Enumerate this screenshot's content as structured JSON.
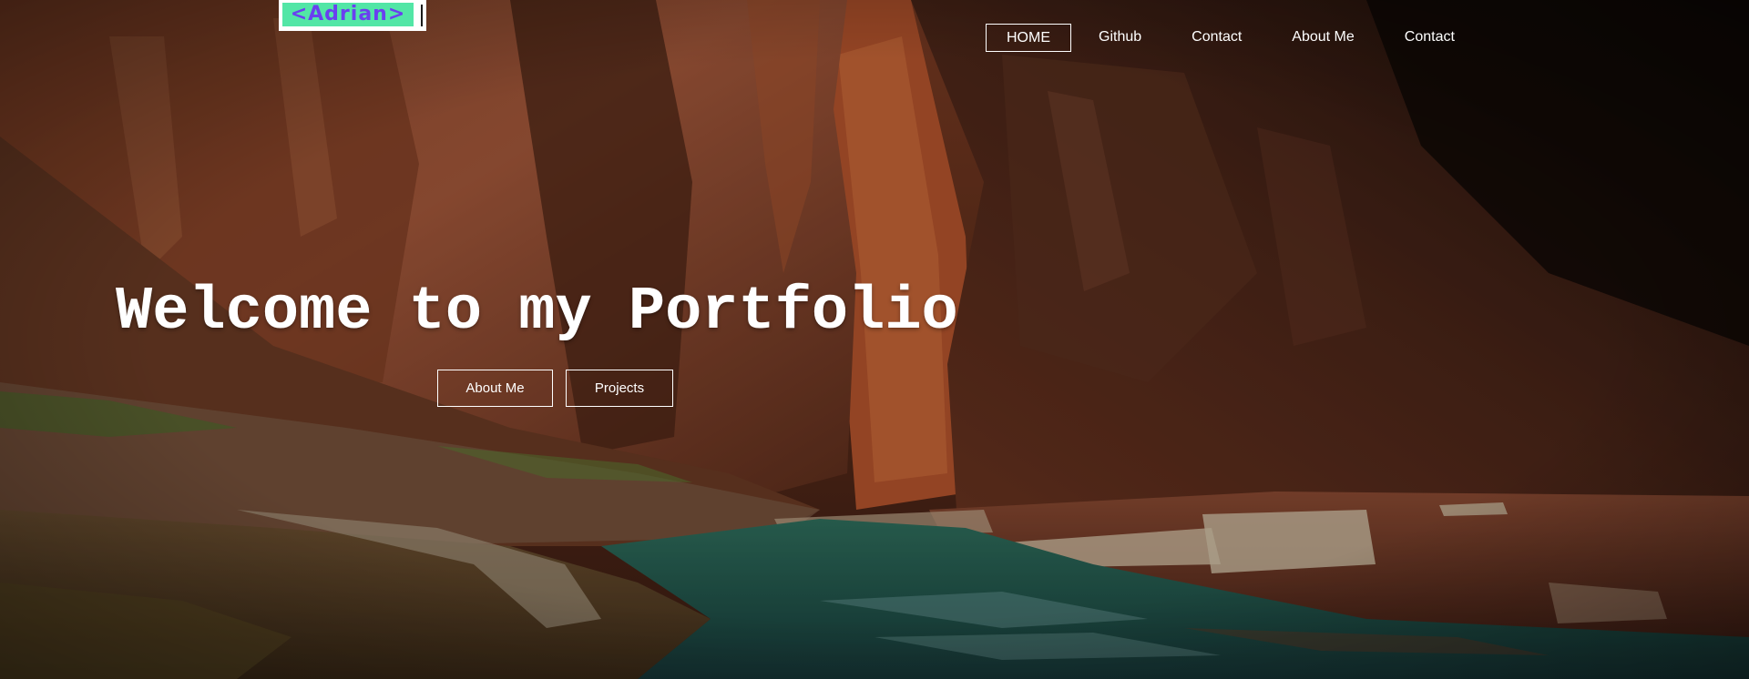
{
  "logo": {
    "text": "<Adrian>"
  },
  "nav": {
    "items": [
      {
        "label": "HOME",
        "active": true
      },
      {
        "label": "Github",
        "active": false
      },
      {
        "label": "Contact",
        "active": false
      },
      {
        "label": "About Me",
        "active": false
      },
      {
        "label": "Contact",
        "active": false
      }
    ]
  },
  "hero": {
    "title": "Welcome to my Portfolio",
    "buttons": [
      {
        "label": "About Me"
      },
      {
        "label": "Projects"
      }
    ],
    "background": "canyon-river-photo"
  },
  "colors": {
    "logo_bg": "#52e6a6",
    "logo_text": "#6a3ff0",
    "text": "#ffffff"
  }
}
